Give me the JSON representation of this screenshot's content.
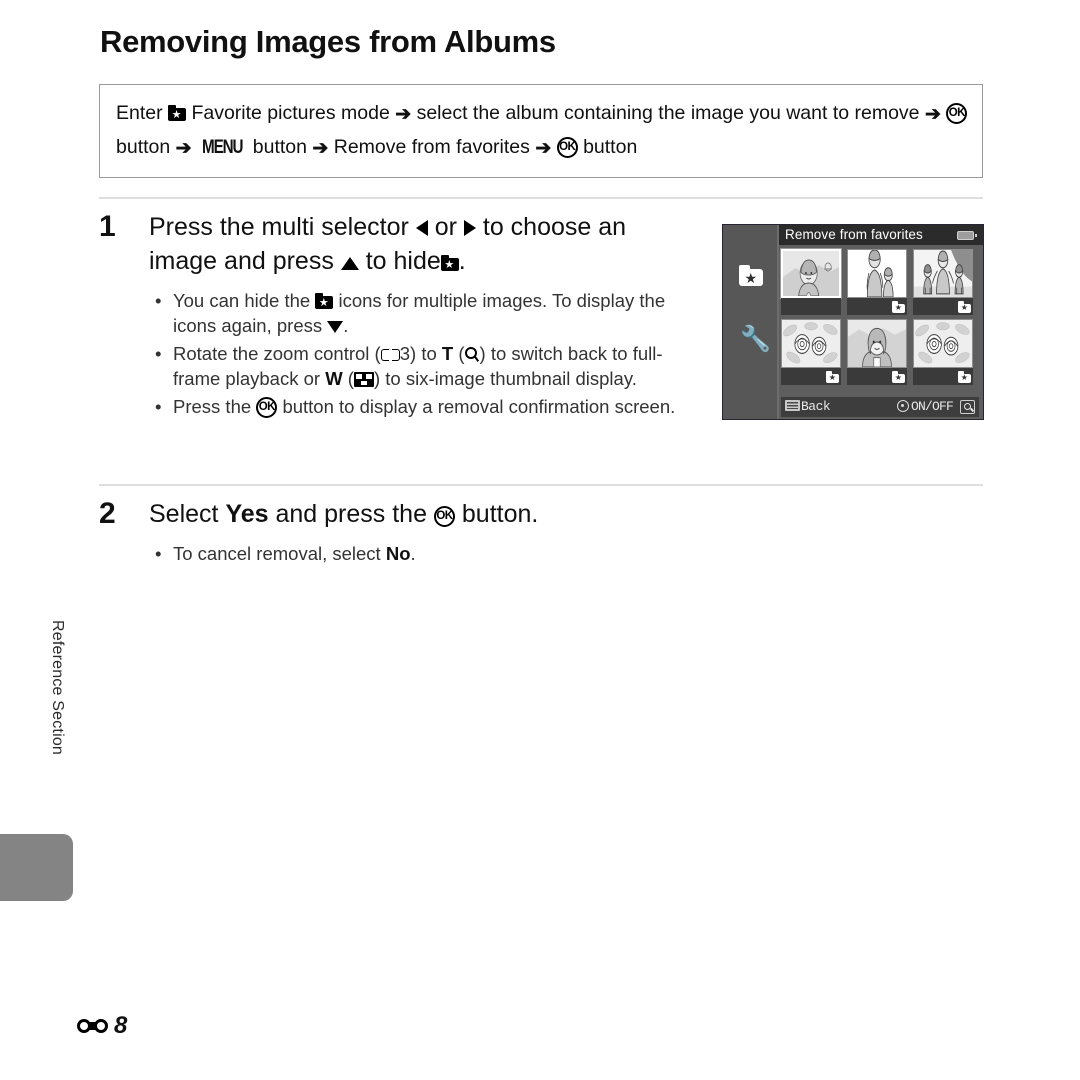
{
  "page": {
    "title": "Removing Images from Albums",
    "side_label": "Reference Section",
    "footer_number": "8",
    "footer_icon": "reference-section-icon"
  },
  "intro": {
    "seg1": "Enter",
    "icon1": "favorites-folder-icon",
    "seg2": "Favorite pictures mode",
    "arrow1": "➔",
    "seg3": "select the album containing the image you want to remove",
    "arrow2": "➔",
    "icon2": "ok-button-icon",
    "seg4": "button",
    "arrow3": "➔",
    "icon3": "MENU",
    "seg5": "button",
    "arrow4": "➔",
    "seg6": "Remove from favorites",
    "arrow5": "➔",
    "icon4": "ok-button-icon",
    "seg7": "button"
  },
  "steps": [
    {
      "number": "1",
      "head_a": "Press the multi selector",
      "head_icon_left": "left-triangle-icon",
      "head_b": "or",
      "head_icon_right": "right-triangle-icon",
      "head_c": "to choose an image and press",
      "head_icon_up": "up-triangle-icon",
      "head_d": "to hide",
      "head_icon_fav": "favorites-folder-icon",
      "head_e": ".",
      "bullets": [
        {
          "a": "You can hide the",
          "icon": "favorites-folder-icon",
          "b": "icons for multiple images. To display the icons again, press",
          "icon2": "down-triangle-icon",
          "c": "."
        },
        {
          "a": "Rotate the zoom control (",
          "icon": "book-reference-icon",
          "page": "3",
          "b": ") to",
          "t": "T",
          "c": "(",
          "icon2": "magnifier-icon",
          "d": ") to switch back to full-frame playback or",
          "w": "W",
          "e": "(",
          "icon3": "thumbnail-grid-icon",
          "f": ") to six-image thumbnail display."
        },
        {
          "a": "Press the",
          "icon": "ok-button-icon",
          "b": "button to display a removal confirmation screen."
        }
      ]
    },
    {
      "number": "2",
      "head_a": "Select",
      "head_bold1": "Yes",
      "head_b": "and press the",
      "head_icon_ok": "ok-button-icon",
      "head_c": "button.",
      "bullets": [
        {
          "a": "To cancel removal, select",
          "bold": "No",
          "b": "."
        }
      ]
    }
  ],
  "lcd": {
    "title": "Remove from favorites",
    "battery_icon": "battery-icon",
    "sidebar": [
      {
        "name": "favorite-pictures-tab",
        "icon": "favorites-folder-icon",
        "selected": true
      },
      {
        "name": "setup-menu-tab",
        "icon": "wrench-icon",
        "selected": false
      }
    ],
    "thumbnails": [
      {
        "id": 1,
        "scene": "woman-portrait-outdoors",
        "selected": true,
        "star": false
      },
      {
        "id": 2,
        "scene": "woman-with-child",
        "selected": false,
        "star": true
      },
      {
        "id": 3,
        "scene": "woman-with-two-children",
        "selected": false,
        "star": true
      },
      {
        "id": 4,
        "scene": "flowers",
        "selected": false,
        "star": true
      },
      {
        "id": 5,
        "scene": "woman-portrait",
        "selected": false,
        "star": true
      },
      {
        "id": 6,
        "scene": "flowers",
        "selected": false,
        "star": true
      }
    ],
    "bottom_bar": {
      "back_icon": "menu-button-icon",
      "back_label": "Back",
      "dial_icon": "multi-selector-icon",
      "onoff_label": "ON/OFF",
      "zoom_icon": "magnifier-icon"
    }
  },
  "colors": {
    "rule": "#dedede",
    "box_border": "#9a9a9a",
    "side_tab": "#848484",
    "lcd_bg": "#5e5e5e",
    "lcd_titlebar": "#2b2b2b"
  }
}
